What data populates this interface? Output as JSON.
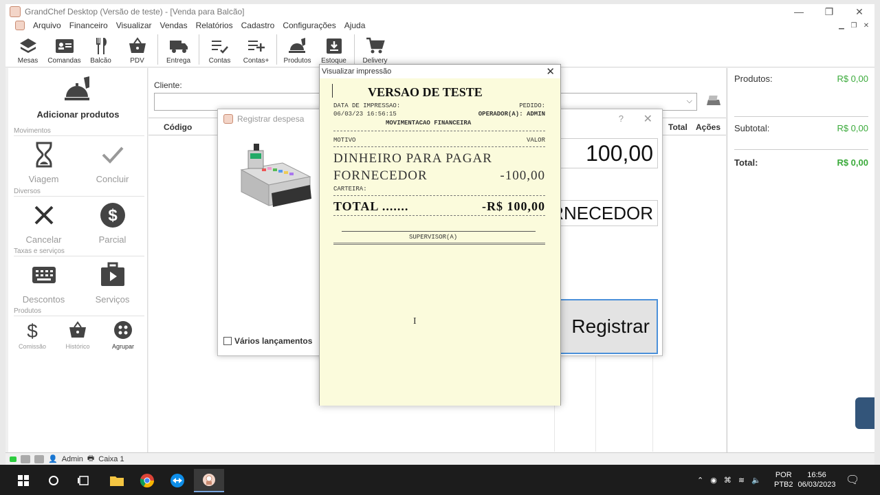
{
  "window": {
    "title": "GrandChef Desktop (Versão de teste) - [Venda para Balcão]",
    "controls": {
      "minimize": "—",
      "restore": "❐",
      "close": "✕"
    }
  },
  "menu": [
    "Arquivo",
    "Financeiro",
    "Visualizar",
    "Vendas",
    "Relatórios",
    "Cadastro",
    "Configurações",
    "Ajuda"
  ],
  "toolbar": {
    "mesas": "Mesas",
    "comandas": "Comandas",
    "balcao": "Balcão",
    "pdv": "PDV",
    "entrega": "Entrega",
    "contas": "Contas",
    "contas_plus": "Contas+",
    "produtos": "Produtos",
    "estoque": "Estoque",
    "delivery": "Delivery"
  },
  "left": {
    "add_products": "Adicionar produtos",
    "section_movimentos": "Movimentos",
    "viagem": "Viagem",
    "concluir": "Concluir",
    "section_diversos": "Diversos",
    "cancelar": "Cancelar",
    "parcial": "Parcial",
    "section_taxas": "Taxas e serviços",
    "descontos": "Descontos",
    "servicos": "Serviços",
    "section_produtos": "Produtos",
    "comissao": "Comissão",
    "historico": "Histórico",
    "agrupar": "Agrupar"
  },
  "center": {
    "client_label": "Cliente:",
    "columns": {
      "codigo": "Código",
      "total": "Total",
      "acoes": "Ações"
    }
  },
  "summary": {
    "produtos_label": "Produtos:",
    "produtos_value": "R$ 0,00",
    "subtotal_label": "Subtotal:",
    "subtotal_value": "R$ 0,00",
    "total_label": "Total:",
    "total_value": "R$ 0,00"
  },
  "status": {
    "user": "Admin",
    "cashier": "Caixa 1"
  },
  "register_dialog": {
    "title": "Registrar despesa",
    "help": "?",
    "close": "✕",
    "multiple_entries": "Vários lançamentos",
    "value": "100,00",
    "description": "RNECEDOR",
    "submit": "Registrar"
  },
  "print_preview": {
    "title": "Visualizar impressão",
    "close": "✕",
    "receipt": {
      "heading": "VERSAO DE TESTE",
      "print_date_label": "DATA DE IMPRESSAO:",
      "order_label": "PEDIDO:",
      "print_date": "06/03/23 16:56:15",
      "operator": "OPERADOR(A): ADMIN",
      "movement": "MOVIMENTACAO FINANCEIRA",
      "col_reason": "MOTIVO",
      "col_value": "VALOR",
      "line1": "DINHEIRO PARA PAGAR",
      "line2": "FORNECEDOR",
      "line2_value": "-100,00",
      "wallet_label": "CARTEIRA:",
      "total_label": "TOTAL .......",
      "total_value": "-R$ 100,00",
      "supervisor": "SUPERVISOR(A)"
    }
  },
  "taskbar": {
    "lang1": "POR",
    "lang2": "PTB2",
    "time": "16:56",
    "date": "06/03/2023"
  }
}
